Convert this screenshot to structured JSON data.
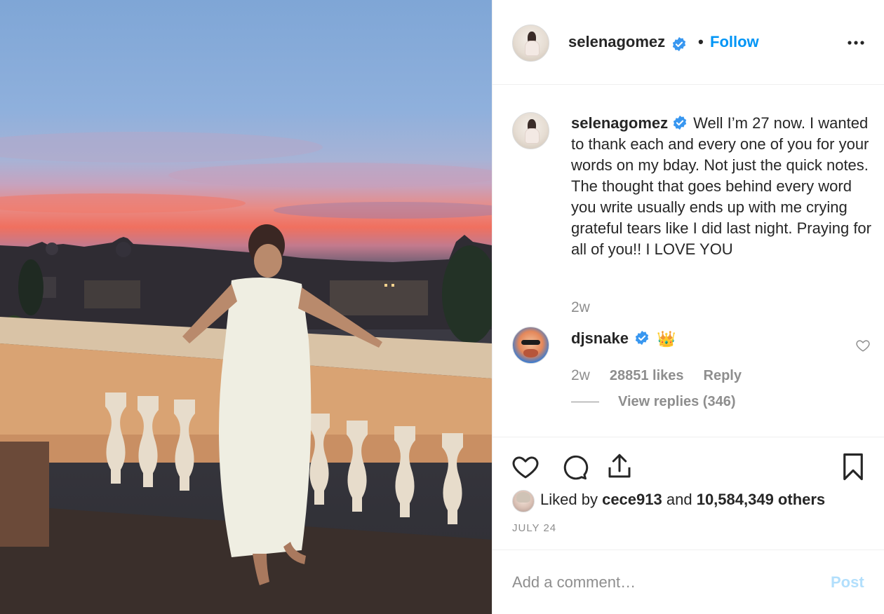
{
  "header": {
    "username": "selenagomez",
    "separator": "•",
    "follow_label": "Follow",
    "more_icon": "more-horizontal-icon"
  },
  "caption": {
    "username": "selenagomez",
    "text": "Well I’m 27 now. I wanted to thank each and every one of you for your words on my bday. Not just the quick notes. The thought that goes behind every word you write usually ends up with me crying grateful tears like I did last night. Praying for all of you!! I LOVE YOU",
    "time": "2w"
  },
  "comments": [
    {
      "username": "djsnake",
      "emoji": "👑",
      "time": "2w",
      "likes": "28851 likes",
      "reply_label": "Reply",
      "view_replies": "View replies (346)"
    }
  ],
  "actions": {
    "like_icon": "heart-icon",
    "comment_icon": "comment-icon",
    "share_icon": "share-icon",
    "save_icon": "bookmark-icon"
  },
  "likes": {
    "prefix": "Liked by",
    "user": "cece913",
    "and": "and",
    "count": "10,584,349 others"
  },
  "post_date": "JULY 24",
  "comment_box": {
    "placeholder": "Add a comment…",
    "post_label": "Post"
  },
  "colors": {
    "accent": "#0095f6",
    "verified": "#3897f0",
    "muted": "#8e8e8e",
    "post_disabled": "#b2dffc"
  }
}
